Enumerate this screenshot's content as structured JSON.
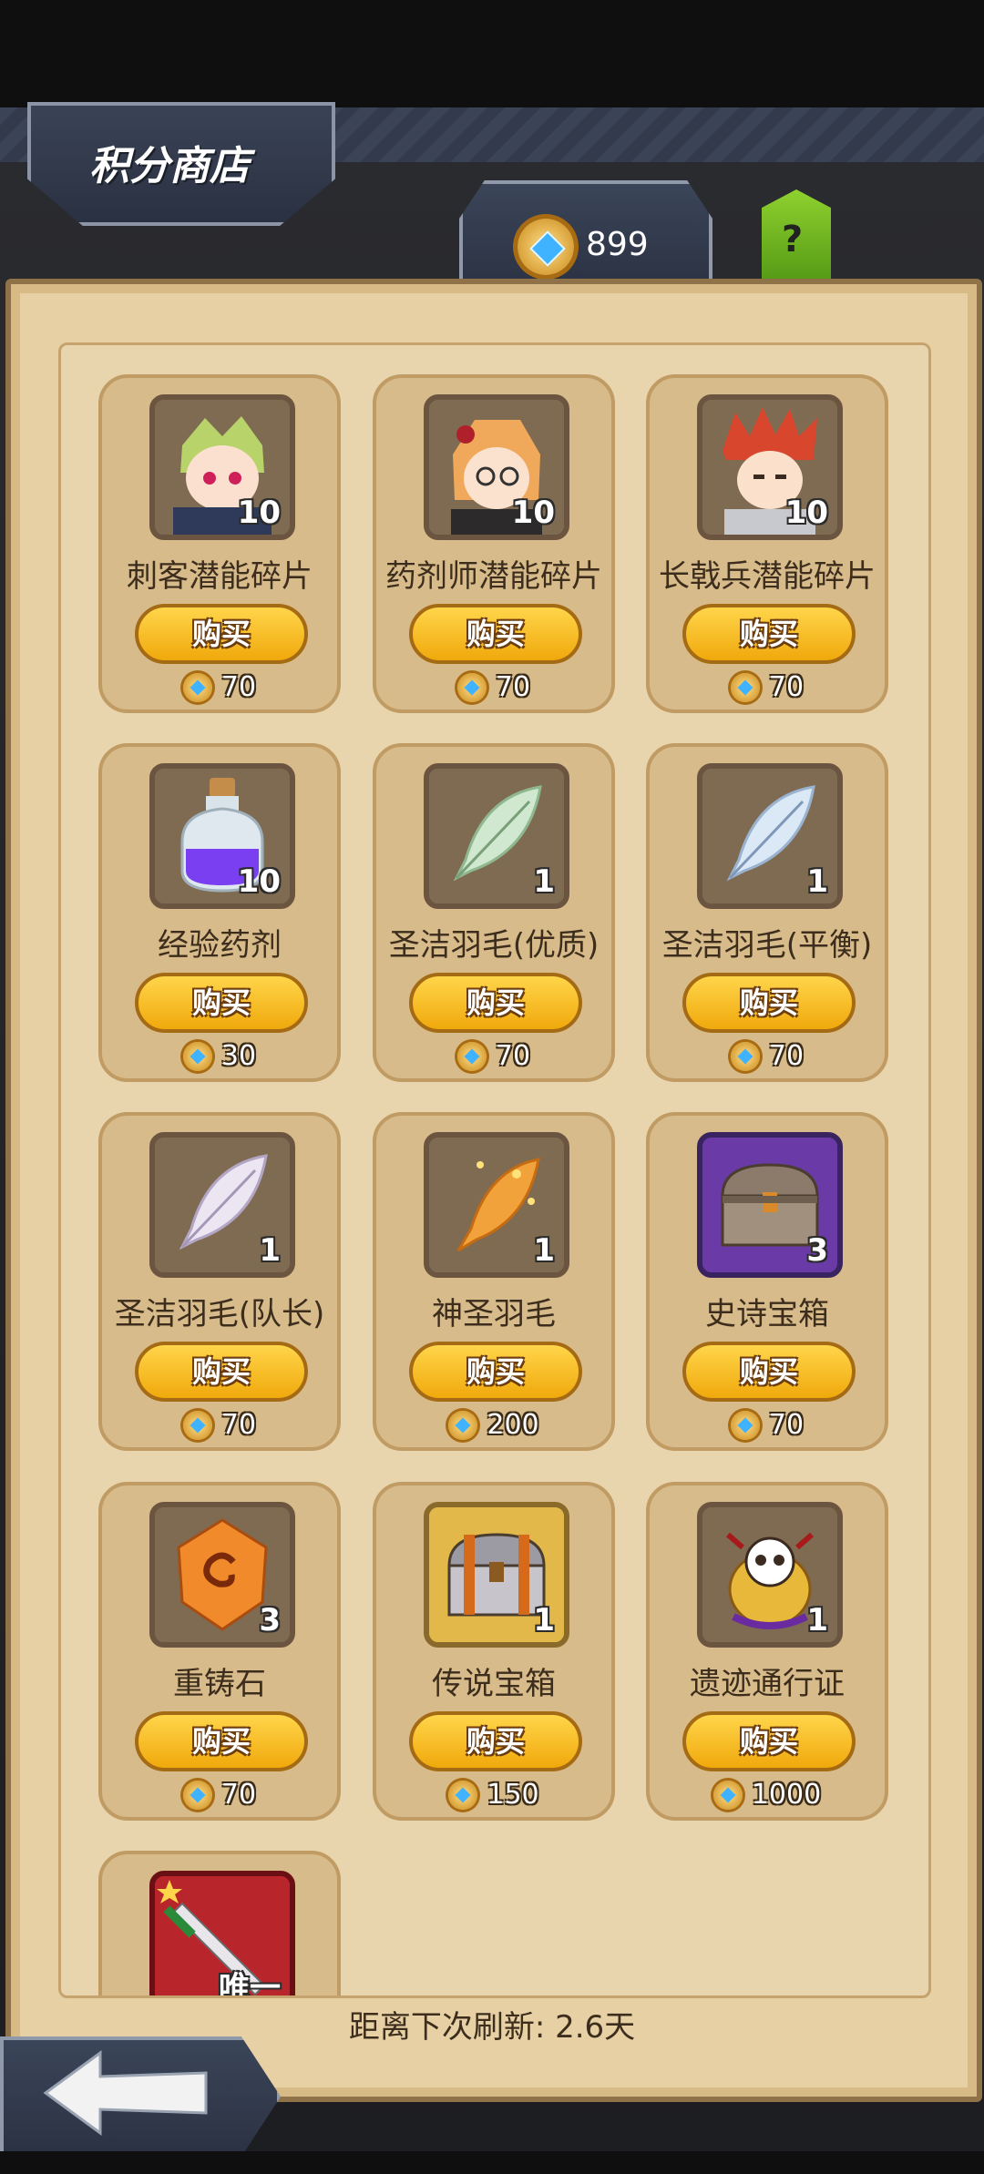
{
  "header": {
    "title": "积分商店",
    "currency_value": "899",
    "help_label": "?"
  },
  "shop": {
    "buy_label": "购买",
    "items": [
      {
        "name": "刺客潜能碎片",
        "qty": "10",
        "price": "70",
        "icon": "assassin-portrait-icon"
      },
      {
        "name": "药剂师潜能碎片",
        "qty": "10",
        "price": "70",
        "icon": "alchemist-portrait-icon"
      },
      {
        "name": "长戟兵潜能碎片",
        "qty": "10",
        "price": "70",
        "icon": "halberdier-portrait-icon"
      },
      {
        "name": "经验药剂",
        "qty": "10",
        "price": "30",
        "icon": "potion-icon"
      },
      {
        "name": "圣洁羽毛(优质)",
        "qty": "1",
        "price": "70",
        "icon": "green-feather-icon"
      },
      {
        "name": "圣洁羽毛(平衡)",
        "qty": "1",
        "price": "70",
        "icon": "blue-feather-icon"
      },
      {
        "name": "圣洁羽毛(队长)",
        "qty": "1",
        "price": "70",
        "icon": "white-feather-icon"
      },
      {
        "name": "神圣羽毛",
        "qty": "1",
        "price": "200",
        "icon": "golden-feather-icon"
      },
      {
        "name": "史诗宝箱",
        "qty": "3",
        "price": "70",
        "icon": "epic-chest-icon"
      },
      {
        "name": "重铸石",
        "qty": "3",
        "price": "70",
        "icon": "reforge-stone-icon"
      },
      {
        "name": "传说宝箱",
        "qty": "1",
        "price": "150",
        "icon": "legendary-chest-icon"
      },
      {
        "name": "遗迹通行证",
        "qty": "1",
        "price": "1000",
        "icon": "ruins-pass-icon"
      },
      {
        "name": "",
        "qty": "唯一",
        "price": "",
        "icon": "unique-weapon-icon"
      }
    ]
  },
  "footer": {
    "refresh_text": "距离下次刷新: 2.6天"
  }
}
